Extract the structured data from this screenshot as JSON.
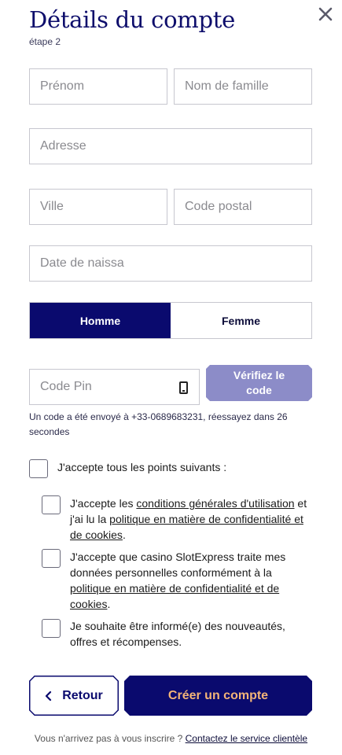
{
  "header": {
    "title": "Détails du compte",
    "step": "étape 2",
    "close_icon": "close-icon"
  },
  "form": {
    "first_name_placeholder": "Prénom",
    "last_name_placeholder": "Nom de famille",
    "address_placeholder": "Adresse",
    "city_placeholder": "Ville",
    "postal_code_placeholder": "Code postal",
    "birthdate_placeholder": "Date de naissa",
    "gender": {
      "options": [
        "Homme",
        "Femme"
      ],
      "selected": "Homme"
    },
    "pin_placeholder": "Code Pin",
    "pin_icon": "phone-icon",
    "verify_label_line1": "Vérifiez le",
    "verify_label_line2": "code",
    "code_info": "Un code a été envoyé à +33-0689683231, réessayez dans 26 secondes"
  },
  "consents": {
    "accept_all": "J'accepte tous les points suivants :",
    "terms": {
      "prefix": "J'accepte les ",
      "link1": "conditions générales d'utilisation",
      "middle": " et j'ai lu la ",
      "link2": "politique en matière de confidentialité et de cookies",
      "suffix": "."
    },
    "data_processing": {
      "prefix": "J'accepte que casino SlotExpress traite mes données personnelles conformément à la ",
      "link": "politique en matière de confidentialité et de cookies",
      "suffix": "."
    },
    "newsletter": "Je souhaite être informé(e) des nouveautés, offres et récompenses."
  },
  "actions": {
    "back_label": "Retour",
    "back_icon": "chevron-left-icon",
    "create_label": "Créer un compte"
  },
  "footer": {
    "text": "Vous n'arrivez pas à vous inscrire ? ",
    "link": "Contactez le service clientèle"
  },
  "colors": {
    "primary": "#0a0a6e",
    "accent": "#f3b478",
    "verify_bg": "#8c8cc8",
    "border": "#c7c7cf"
  }
}
